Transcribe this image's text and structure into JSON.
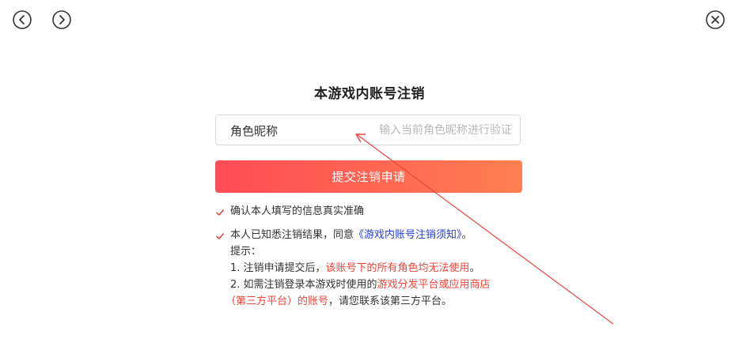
{
  "nav": {
    "back_icon": "chevron-left-circle",
    "forward_icon": "chevron-right-circle",
    "close_icon": "x-circle"
  },
  "title": "本游戏内账号注销",
  "field": {
    "label": "角色昵称",
    "placeholder": "输入当前角色昵称进行验证",
    "value": ""
  },
  "submit_label": "提交注销申请",
  "checks": [
    {
      "checked": true,
      "text": "确认本人填写的信息真实准确"
    },
    {
      "checked": true,
      "text_before": "本人已知悉注销结果，同意",
      "link": "《游戏内账号注销须知》",
      "text_after": "。"
    }
  ],
  "tips": {
    "heading": "提示：",
    "item1_prefix": "1. 注销申请提交后，",
    "item1_highlight": "该账号下的所有角色均无法使用",
    "item1_suffix": "。",
    "item2_prefix": "2. 如需注销登录本游戏时使用的",
    "item2_highlight_1": "游戏分发平台或应用商店",
    "item2_highlight_2": "（第三方平台）的账号",
    "item2_suffix": "，请您联系该第三方平台。"
  },
  "colors": {
    "accent_start": "#ff4b55",
    "accent_end": "#ff7f50",
    "link": "#1f3fcf",
    "highlight": "#e8473c",
    "annotation_arrow": "#e8473c"
  }
}
